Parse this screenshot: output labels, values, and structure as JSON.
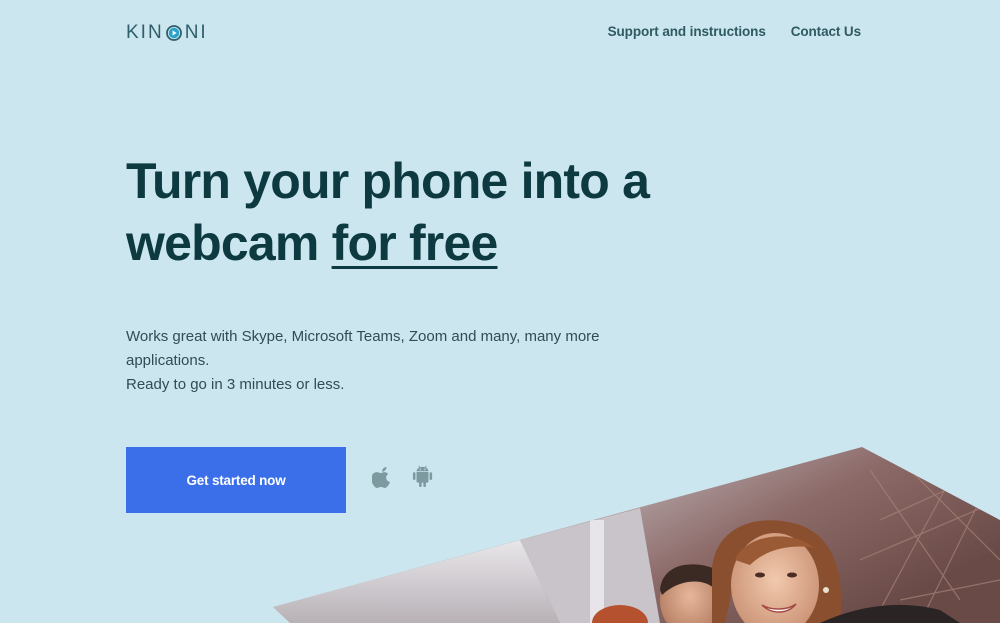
{
  "header": {
    "logo_before": "KIN",
    "logo_after": "NI",
    "nav": [
      {
        "label": "Support and instructions"
      },
      {
        "label": "Contact Us"
      }
    ]
  },
  "hero": {
    "title_line1": "Turn your phone into a",
    "title_line2_plain": "webcam ",
    "title_line2_underlined": "for free",
    "description_line1": "Works great with Skype, Microsoft Teams, Zoom and many, many more applications.",
    "description_line2": "Ready to go in 3 minutes or less.",
    "cta_label": "Get started now"
  },
  "platforms": {
    "icons": [
      "apple-icon",
      "android-icon"
    ]
  },
  "colors": {
    "background": "#cce6ef",
    "heading": "#0c3a40",
    "cta": "#3b6fea",
    "icon": "#7c9aa0",
    "logo_accent": "#2aa3c9"
  }
}
